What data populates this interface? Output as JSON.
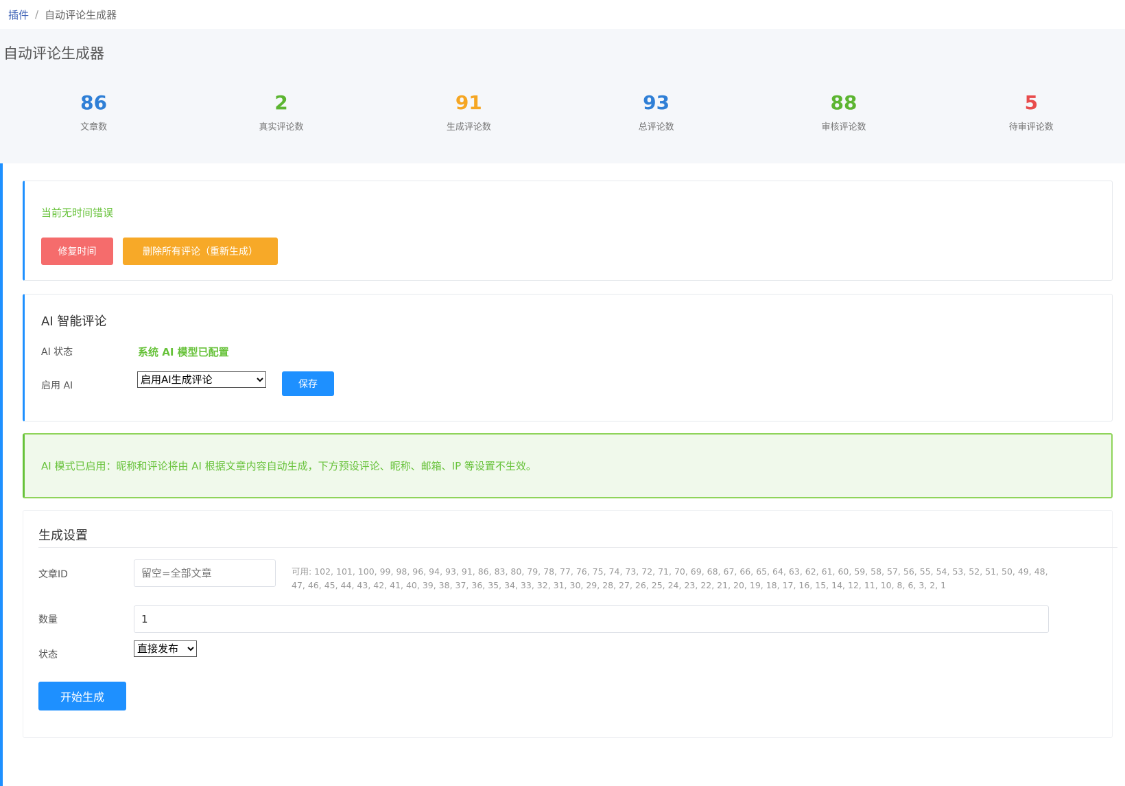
{
  "breadcrumb": {
    "root": "插件",
    "separator": "/",
    "current": "自动评论生成器"
  },
  "page_title": "自动评论生成器",
  "stats": [
    {
      "value": "86",
      "label": "文章数",
      "color": "#2f7fd6"
    },
    {
      "value": "2",
      "label": "真实评论数",
      "color": "#5cb531"
    },
    {
      "value": "91",
      "label": "生成评论数",
      "color": "#f5a623"
    },
    {
      "value": "93",
      "label": "总评论数",
      "color": "#2f7fd6"
    },
    {
      "value": "88",
      "label": "审核评论数",
      "color": "#5cb531"
    },
    {
      "value": "5",
      "label": "待审评论数",
      "color": "#e84c4c"
    }
  ],
  "time_card": {
    "message": "当前无时间错误",
    "fix_button": "修复时间",
    "delete_button": "删除所有评论（重新生成）"
  },
  "ai_card": {
    "heading": "AI 智能评论",
    "status_label": "AI 状态",
    "status_value": "系统 AI 模型已配置",
    "enable_label": "启用 AI",
    "enable_selected": "启用AI生成评论",
    "save_button": "保存"
  },
  "notice": "AI 模式已启用：昵称和评论将由 AI 根据文章内容自动生成，下方预设评论、昵称、邮箱、IP 等设置不生效。",
  "gen_card": {
    "heading": "生成设置",
    "article_id_label": "文章ID",
    "article_id_placeholder": "留空=全部文章",
    "available_ids": "可用: 102, 101, 100, 99, 98, 96, 94, 93, 91, 86, 83, 80, 79, 78, 77, 76, 75, 74, 73, 72, 71, 70, 69, 68, 67, 66, 65, 64, 63, 62, 61, 60, 59, 58, 57, 56, 55, 54, 53, 52, 51, 50, 49, 48, 47, 46, 45, 44, 43, 42, 41, 40, 39, 38, 37, 36, 35, 34, 33, 32, 31, 30, 29, 28, 27, 26, 25, 24, 23, 22, 21, 20, 19, 18, 17, 16, 15, 14, 12, 11, 10, 8, 6, 3, 2, 1",
    "quantity_label": "数量",
    "quantity_value": "1",
    "status_label": "状态",
    "status_selected": "直接发布",
    "start_button": "开始生成"
  }
}
